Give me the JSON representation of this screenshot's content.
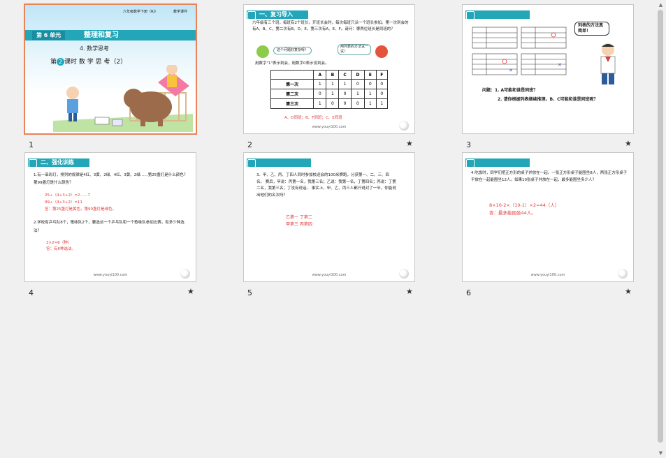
{
  "slides": [
    {
      "number": "1",
      "grade_label": "六年级数学下册（RJ）",
      "courseware_label": "教学课件",
      "unit_badge": "第 6 单元",
      "unit_title": "整理和复习",
      "subtitle": "4. 数学思考",
      "lesson_pre": "第",
      "lesson_num": "2",
      "lesson_post": "课时   数 学 思 考（2）"
    },
    {
      "number": "2",
      "header": "一、复习导入",
      "para": "六年级有三个班，每班有2个班长，开班长会时，每次每班只派一个班长参加。第一次到会的有A、B、C，第二次有B、D、E，第三次有A、E、F。请问：哪两位班长是同班的？",
      "bubble1": "这个问题好复杂呀！",
      "bubble2": "用列表的方法试一试！",
      "note": "用数字\"1\"表示到会，用数字0表示没到会。",
      "table_cols": [
        "",
        "A",
        "B",
        "C",
        "D",
        "E",
        "F"
      ],
      "table_rows": [
        [
          "第一次",
          "1",
          "1",
          "1",
          "0",
          "0",
          "0"
        ],
        [
          "第二次",
          "0",
          "1",
          "0",
          "1",
          "1",
          "0"
        ],
        [
          "第三次",
          "1",
          "0",
          "0",
          "0",
          "1",
          "1"
        ]
      ],
      "answer": "A、D同班；B、F同班；C、E同班",
      "url": "www.youyi100.com"
    },
    {
      "number": "3",
      "bubble": "列表的方法真简单！",
      "q1": "问题：1. A可能和谁是同班？",
      "q2": "2. 请你根据列表继续推理，B、C可能和谁是同班呢？"
    },
    {
      "number": "4",
      "header": "二、强化训练",
      "p1": "1.有一串彩灯，排列的规律是4红、3黄、2绿、4红、3黄、2绿……第25盏灯是什么颜色？第99盏灯是什么颜色？",
      "a1": "25÷（4+3+2）=2……7",
      "a2": "99÷（4+3+2）=11",
      "a3": "答：第25盏灯是黄色，第99盏灯是绿色。",
      "p2": "2.学校有乒乓队8个，歌咏队2个，要选派一个乒乓队和一个歌咏队参加比赛，有多少种选法？",
      "a4": "3×2=6（种）",
      "a5": "答：有6种选法。",
      "url": "www.youyi100.com"
    },
    {
      "number": "5",
      "p": "3．甲、乙、丙、丁四人同时参加校运会的100米赛跑，分获第一、二、三、四名。 赛后，甲说：丙第一名，我第三名；乙说：我第一名，丁第四名；丙说：丁第二名，我第三名；丁没有说话。 事实上，甲、乙、丙三人都只说对了一半，你能说出他们的名次吗？",
      "a1": "乙第一   丁第二",
      "a2": "甲第三   丙第四",
      "url": "www.youyi100.com"
    },
    {
      "number": "6",
      "p": "4.吃饭时，同学们把正方形的桌子并放在一起。一张正方形桌子能围坐8人，两张正方形桌子平放在一起能围坐12人。如果10张桌子并放在一起，最多能围坐多少人？",
      "a1": "8×10-2×（10-1）×2=44（人）",
      "a2": "答：最多能围坐44人。",
      "url": "www.youyi100.com"
    }
  ],
  "star_glyph": "★",
  "accent": "#23a6b8",
  "selected_border": "#e8845a"
}
